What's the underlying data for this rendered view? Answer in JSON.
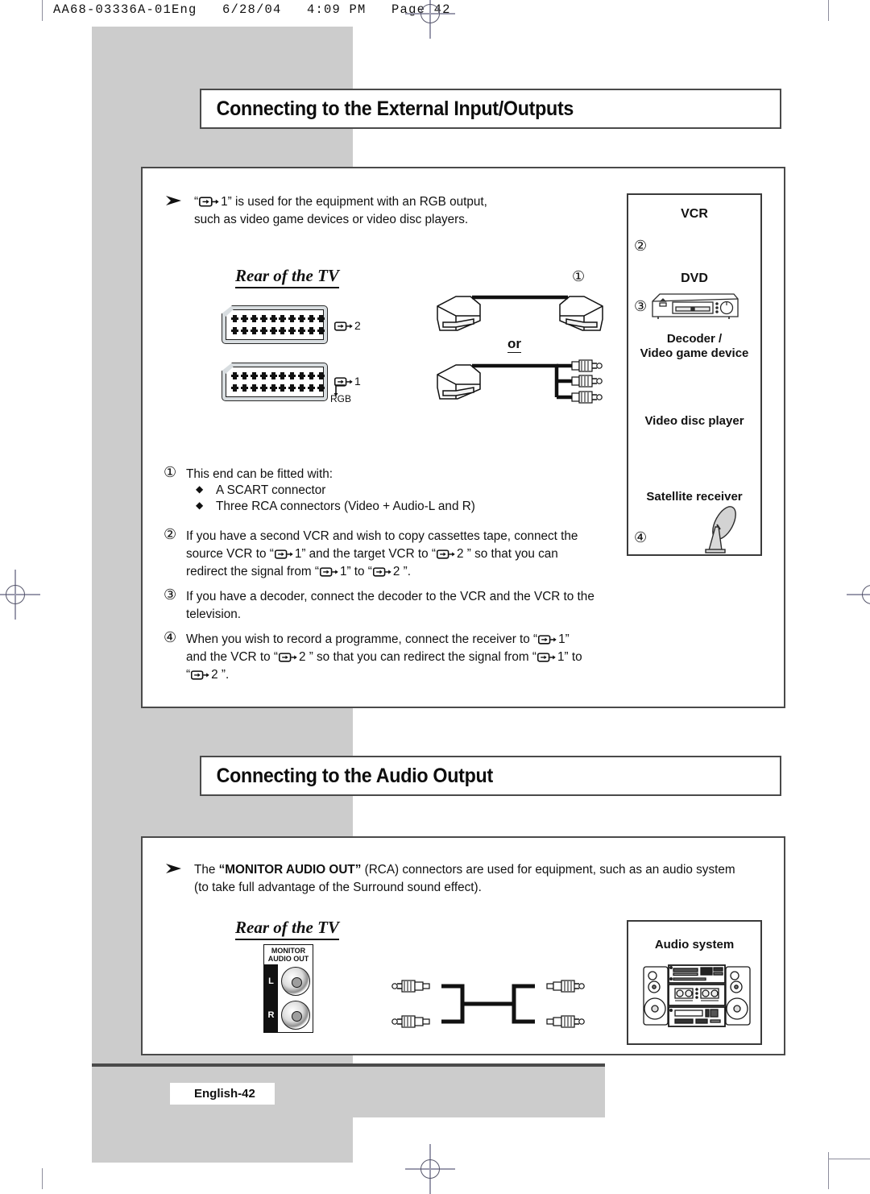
{
  "print_header": "AA68-03336A-01Eng   6/28/04   4:09 PM   Page 42",
  "sections": [
    {
      "id": "external-io",
      "title": "Connecting to the External Input/Outputs",
      "intro": {
        "bullet": "➢",
        "line1_pre": "“",
        "line1_post": "1” is used for the equipment with an RGB output,",
        "line2": "such as video game devices or video disc players."
      },
      "diagram": {
        "rear_label": "Rear of the TV",
        "socket_top_label": "2",
        "socket_bottom_label": "1",
        "rgb_label": "RGB",
        "or_label": "or",
        "callout_one": "①"
      },
      "device_box": {
        "items": [
          {
            "label": "VCR",
            "marker": "②"
          },
          {
            "label": "DVD",
            "marker": "③"
          },
          {
            "label": "Decoder /",
            "marker": ""
          },
          {
            "label": "Video game device",
            "marker": ""
          },
          {
            "label": "Video disc player",
            "marker": ""
          },
          {
            "label": "Satellite receiver",
            "marker": "④"
          }
        ]
      },
      "notes": [
        {
          "marker": "①",
          "lines": [
            "This end can be fitted with:"
          ],
          "sub_bullets": [
            "A SCART connector",
            "Three RCA connectors (Video + Audio-L and R)"
          ]
        },
        {
          "marker": "②",
          "lines": [
            "If you have a second VCR and wish to copy cassettes tape, connect the",
            "source VCR to “⎇ 1” and the target VCR to “⎇ 2 ” so that you can",
            "redirect the signal from “⎇ 1” to “⎇ 2 ”."
          ]
        },
        {
          "marker": "③",
          "lines": [
            "If you have a decoder, connect the decoder to the VCR and the VCR to the",
            "television."
          ]
        },
        {
          "marker": "④",
          "lines": [
            "When you wish to record a programme, connect the receiver to “⎇ 1”",
            "and the VCR to “⎇ 2 ” so that you can redirect the signal from “⎇ 1” to",
            "“⎇ 2 ”."
          ]
        }
      ]
    },
    {
      "id": "audio-output",
      "title": "Connecting to the Audio Output",
      "intro": {
        "bullet": "➢",
        "line1_a": "The ",
        "line1_bold": "“MONITOR AUDIO OUT”",
        "line1_b": " (RCA) connectors are used for equipment, such as an audio system",
        "line2": "(to take full advantage of the Surround sound effect)."
      },
      "diagram": {
        "rear_label": "Rear of the TV",
        "panel_title_line1": "MONITOR",
        "panel_title_line2": "AUDIO OUT",
        "jack_left_label": "L",
        "jack_right_label": "R"
      },
      "device_box": {
        "items": [
          {
            "label": "Audio system",
            "marker": ""
          }
        ]
      }
    }
  ],
  "footer": {
    "page_label": "English-42"
  },
  "colors": {
    "band_gray": "#cccccc",
    "border_dark": "#4a4a4a",
    "text": "#111111",
    "reg_mark": "#9a9aad"
  }
}
